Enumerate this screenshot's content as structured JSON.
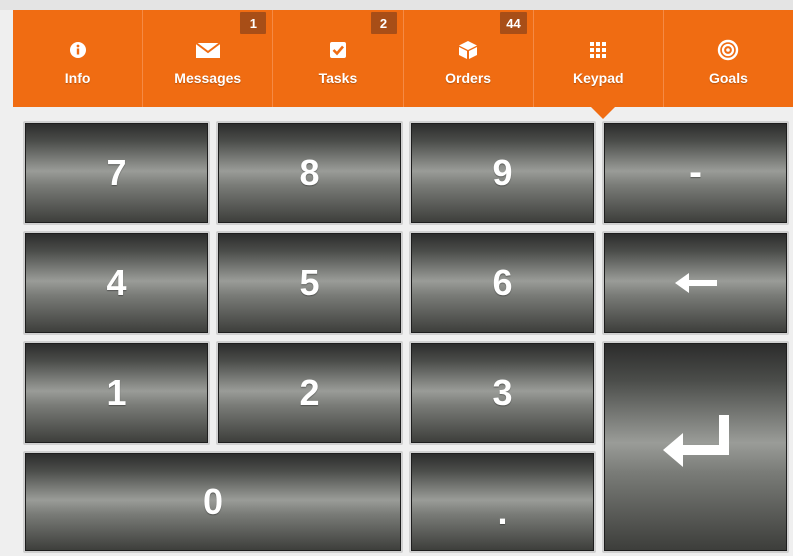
{
  "nav": {
    "tabs": [
      {
        "label": "Info",
        "icon": "info-icon",
        "badge": ""
      },
      {
        "label": "Messages",
        "icon": "envelope-icon",
        "badge": "1"
      },
      {
        "label": "Tasks",
        "icon": "checkbox-icon",
        "badge": "2"
      },
      {
        "label": "Orders",
        "icon": "box-icon",
        "badge": "44"
      },
      {
        "label": "Keypad",
        "icon": "grid-icon",
        "badge": ""
      },
      {
        "label": "Goals",
        "icon": "target-icon",
        "badge": ""
      }
    ],
    "active_tab": "Keypad",
    "colors": {
      "bar": "#f06c12",
      "badge": "#a84e17"
    }
  },
  "keypad": {
    "keys": {
      "k7": "7",
      "k8": "8",
      "k9": "9",
      "minus": "-",
      "k4": "4",
      "k5": "5",
      "k6": "6",
      "k1": "1",
      "k2": "2",
      "k3": "3",
      "k0": "0",
      "dot": "."
    },
    "backspace_icon": "left-arrow-icon",
    "enter_icon": "enter-icon"
  }
}
